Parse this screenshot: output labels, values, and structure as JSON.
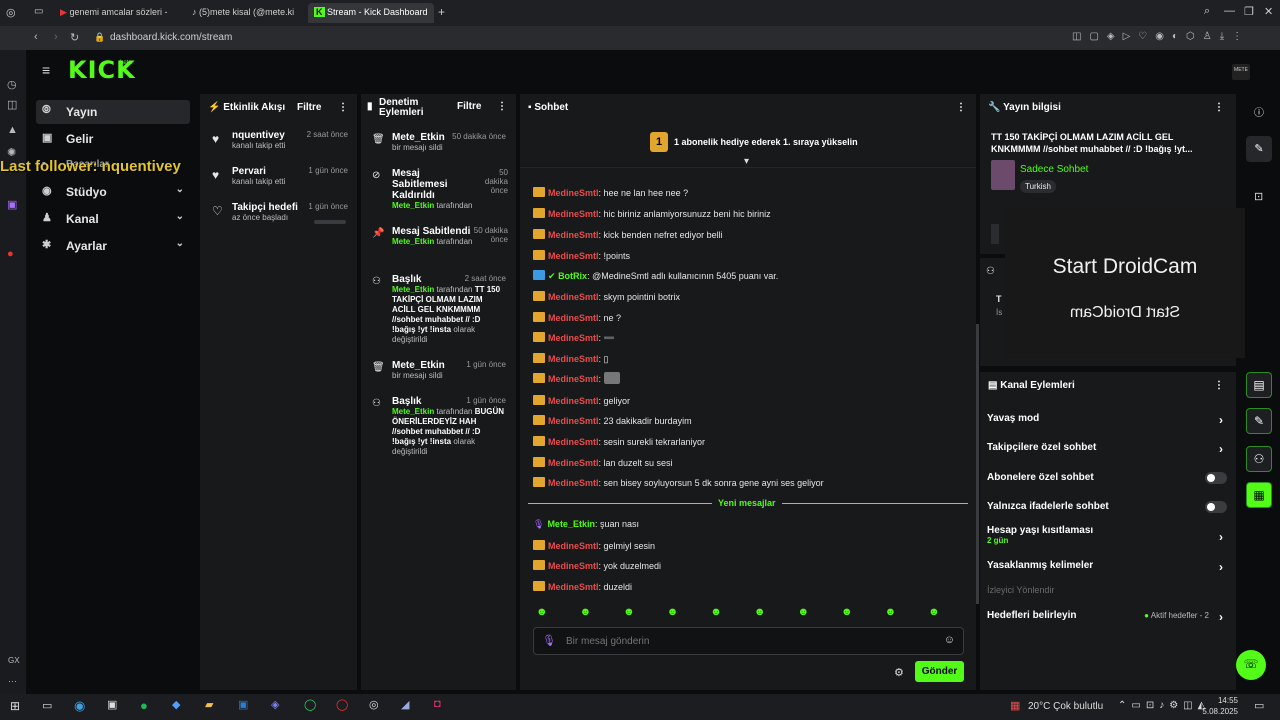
{
  "browser": {
    "tabs": [
      {
        "label": "genemi amcalar sözleri -"
      },
      {
        "label": "(5)mete kisal (@mete.ki"
      },
      {
        "label": "Stream - Kick Dashboard"
      }
    ],
    "url": "dashboard.kick.com/stream"
  },
  "overlay": {
    "last_follower": "Last follower: nquentivey"
  },
  "app": {
    "logo": "KICK",
    "logo_sup": "beta"
  },
  "sidebar": {
    "items": [
      {
        "label": "Yayın"
      },
      {
        "label": "Gelir"
      },
      {
        "label": "Başarılar"
      },
      {
        "label": "Stüdyo"
      },
      {
        "label": "Kanal"
      },
      {
        "label": "Ayarlar"
      }
    ]
  },
  "activity": {
    "title": "Etkinlik Akışı",
    "filter": "Filtre",
    "items": [
      {
        "name": "nquentivey",
        "sub": "kanalı takip etti",
        "time": "2 saat önce"
      },
      {
        "name": "Pervari",
        "sub": "kanalı takip etti",
        "time": "1 gün önce"
      },
      {
        "name": "Takipçi hedefi",
        "sub": "az önce başladı",
        "time": "1 gün önce"
      }
    ]
  },
  "moderation": {
    "title": "Denetim Eylemleri",
    "filter": "Filtre",
    "items": [
      {
        "title": "Mete_Etkin",
        "sub": "bir mesajı sildi",
        "time": "50 dakika önce"
      },
      {
        "title": "Mesaj Sabitlemesi Kaldırıldı",
        "by": "Mete_Etkin",
        "by_suffix": "tarafından",
        "time": "50 dakika önce"
      },
      {
        "title": "Mesaj Sabitlendi",
        "by": "Mete_Etkin",
        "by_suffix": "tarafından",
        "time": "50 dakika önce"
      },
      {
        "title": "Başlık",
        "by": "Mete_Etkin",
        "by_suffix": "tarafından",
        "detail": "TT 150 TAKİPÇİ OLMAM LAZIM ACİLL GEL KNKMMMM //sohbet muhabbet // :D !bağış !yt !insta",
        "detail_suffix": "olarak değiştirildi",
        "time": "2 saat önce"
      },
      {
        "title": "Mete_Etkin",
        "sub": "bir mesajı sildi",
        "time": "1 gün önce"
      },
      {
        "title": "Başlık",
        "by": "Mete_Etkin",
        "by_suffix": "tarafından",
        "detail": "BUGÜN ÖNERİLERDEYİZ HAH //sohbet muhabbet // :D !bağış !yt !insta",
        "detail_suffix": "olarak değiştirildi",
        "time": "1 gün önce"
      }
    ]
  },
  "chat": {
    "title": "Sohbet",
    "banner_rank": "1",
    "banner": "1 abonelik hediye ederek 1. sıraya yükselin",
    "messages": [
      {
        "user": "MedineSmtl",
        "text": ": hee ne lan hee nee ?"
      },
      {
        "user": "MedineSmtl",
        "text": ": hic biriniz anlamiyorsunuzz beni hic biriniz"
      },
      {
        "user": "MedineSmtl",
        "text": ": kick benden nefret ediyor belli"
      },
      {
        "user": "MedineSmtl",
        "text": ": !points"
      },
      {
        "user": "BotRix",
        "text": ": @MedineSmtl adlı kullanıcının 5405 puanı var."
      },
      {
        "user": "MedineSmtl",
        "text": ": skym pointini botrix"
      },
      {
        "user": "MedineSmtl",
        "text": ": ne ?"
      },
      {
        "user": "MedineSmtl",
        "text": ": ➖"
      },
      {
        "user": "MedineSmtl",
        "text": ": ▯"
      },
      {
        "user": "MedineSmtl",
        "text": ":"
      },
      {
        "user": "MedineSmtl",
        "text": ": geliyor"
      },
      {
        "user": "MedineSmtl",
        "text": ": 23 dakikadir burdayim"
      },
      {
        "user": "MedineSmtl",
        "text": ": sesin surekli tekrarlaniyor"
      },
      {
        "user": "MedineSmtl",
        "text": ": lan duzelt su sesi"
      },
      {
        "user": "MedineSmtl",
        "text": ": sen bisey soyluyorsun 5 dk sonra gene ayni ses geliyor"
      }
    ],
    "new_messages": "Yeni mesajlar",
    "new": [
      {
        "user": "Mete_Etkin",
        "text": ": şuan nası"
      },
      {
        "user": "MedineSmtl",
        "text": ": gelmiyl sesin"
      },
      {
        "user": "MedineSmtl",
        "text": ": yok duzelmedi"
      },
      {
        "user": "MedineSmtl",
        "text": ": duzeldi"
      }
    ],
    "placeholder": "Bir mesaj gönderin",
    "send": "Gönder"
  },
  "stream_info": {
    "title": "Yayın bilgisi",
    "stream_title": "TT 150 TAKİPÇİ OLMAM LAZIM ACİLL GEL KNKMMMM //sohbet muhabbet // :D !bağış !yt...",
    "category": "Sadece Sohbet",
    "language": "Turkish"
  },
  "droidcam": {
    "text": "Start DroidCam"
  },
  "channel_actions": {
    "title": "Kanal Eylemleri",
    "rows": [
      {
        "label": "Yavaş mod"
      },
      {
        "label": "Takipçilere özel sohbet"
      },
      {
        "label": "Abonelere özel sohbet"
      },
      {
        "label": "Yalnızca ifadelerle sohbet"
      },
      {
        "label": "Hesap yaşı kısıtlaması",
        "sub": "2 gün"
      },
      {
        "label": "Yasaklanmış kelimeler"
      },
      {
        "label": "İzleyici Yönlendir"
      },
      {
        "label": "Hedefleri belirleyin",
        "extra": "Aktif hedefler - 2"
      }
    ]
  },
  "taskbar": {
    "weather": "20°C  Çok bulutlu",
    "time": "14:55",
    "date": "5.08.2025"
  }
}
